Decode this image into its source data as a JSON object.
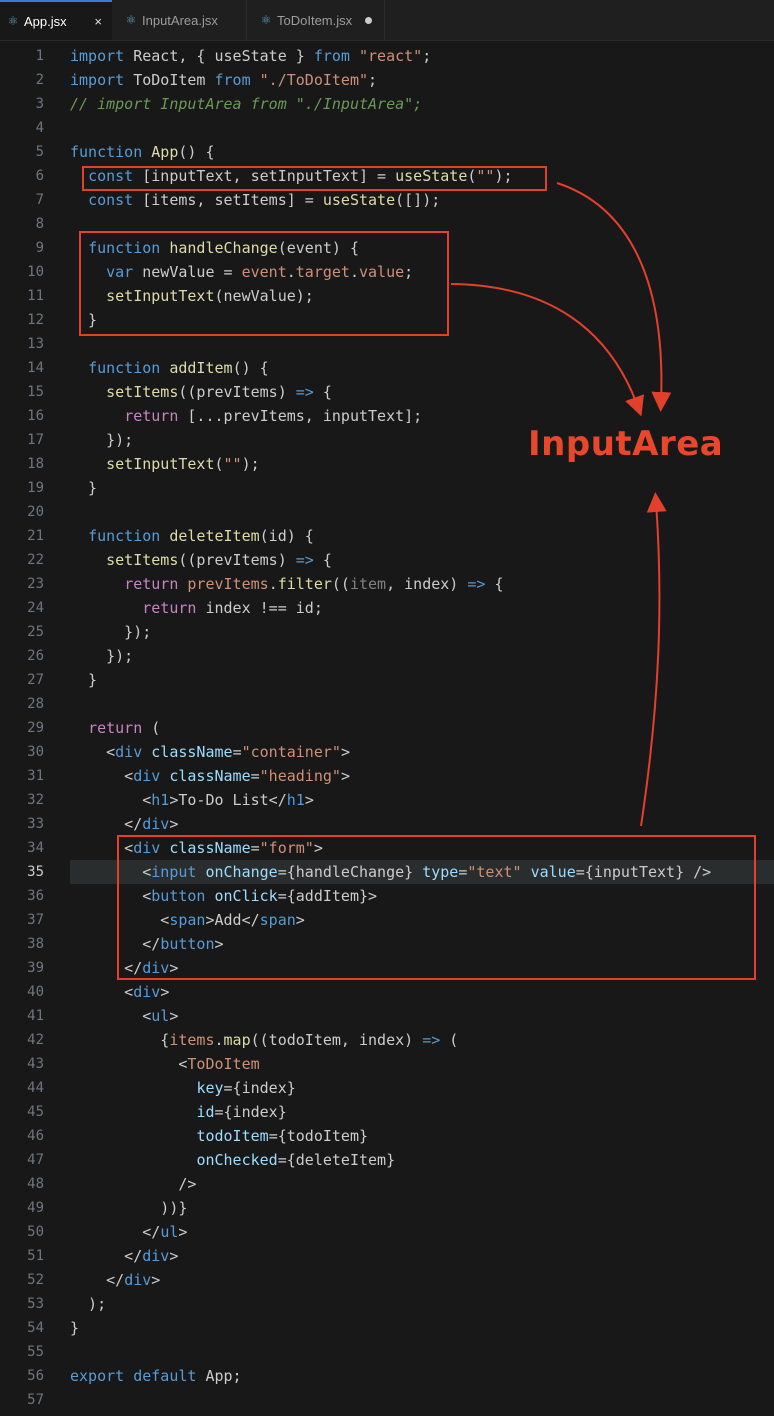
{
  "tabs": [
    {
      "label": "App.jsx",
      "icon": "react-icon",
      "active": true,
      "close": "×"
    },
    {
      "label": "InputArea.jsx",
      "icon": "react-icon",
      "active": false
    },
    {
      "label": "ToDoItem.jsx",
      "icon": "react-icon",
      "active": false,
      "modified": true
    }
  ],
  "annotation": {
    "label": "InputArea",
    "color": "#e2402a"
  },
  "colors": {
    "keyword": "#569cd6",
    "control": "#c586c0",
    "function": "#dcdcaa",
    "string": "#ce9178",
    "variable": "#9cdcfe",
    "comment": "#6a9955"
  },
  "editor": {
    "current_line": 35,
    "lines": [
      {
        "n": "1",
        "tokens": [
          [
            "kw",
            "import"
          ],
          [
            "txt",
            " React, { useState } "
          ],
          [
            "kw",
            "from"
          ],
          [
            "str",
            " \"react\""
          ],
          [
            "txt",
            ";"
          ]
        ]
      },
      {
        "n": "2",
        "tokens": [
          [
            "kw",
            "import"
          ],
          [
            "txt",
            " ToDoItem "
          ],
          [
            "kw",
            "from"
          ],
          [
            "str",
            " \"./ToDoItem\""
          ],
          [
            "txt",
            ";"
          ]
        ]
      },
      {
        "n": "3",
        "tokens": [
          [
            "cm",
            "// import InputArea from \"./InputArea\";"
          ]
        ]
      },
      {
        "n": "4",
        "tokens": []
      },
      {
        "n": "5",
        "tokens": [
          [
            "kw",
            "function"
          ],
          [
            "txt",
            " "
          ],
          [
            "fn",
            "App"
          ],
          [
            "txt",
            "() {"
          ]
        ]
      },
      {
        "n": "6",
        "tokens": [
          [
            "txt",
            "  "
          ],
          [
            "kw",
            "const"
          ],
          [
            "txt",
            " [inputText, setInputText] = "
          ],
          [
            "fn",
            "useState"
          ],
          [
            "txt",
            "("
          ],
          [
            "str",
            "\"\""
          ],
          [
            "txt",
            ");"
          ]
        ]
      },
      {
        "n": "7",
        "tokens": [
          [
            "txt",
            "  "
          ],
          [
            "kw",
            "const"
          ],
          [
            "txt",
            " [items, setItems] = "
          ],
          [
            "fn",
            "useState"
          ],
          [
            "txt",
            "([]);"
          ]
        ]
      },
      {
        "n": "8",
        "tokens": []
      },
      {
        "n": "9",
        "tokens": [
          [
            "txt",
            "  "
          ],
          [
            "kw",
            "function"
          ],
          [
            "txt",
            " "
          ],
          [
            "fn",
            "handleChange"
          ],
          [
            "txt",
            "(event) {"
          ]
        ]
      },
      {
        "n": "10",
        "tokens": [
          [
            "txt",
            "    "
          ],
          [
            "kw",
            "var"
          ],
          [
            "txt",
            " newValue = "
          ],
          [
            "str",
            "event"
          ],
          [
            "txt",
            "."
          ],
          [
            "str",
            "target"
          ],
          [
            "txt",
            "."
          ],
          [
            "str",
            "value"
          ],
          [
            "txt",
            ";"
          ]
        ]
      },
      {
        "n": "11",
        "tokens": [
          [
            "txt",
            "    "
          ],
          [
            "fn",
            "setInputText"
          ],
          [
            "txt",
            "(newValue);"
          ]
        ]
      },
      {
        "n": "12",
        "tokens": [
          [
            "txt",
            "  }"
          ]
        ]
      },
      {
        "n": "13",
        "tokens": []
      },
      {
        "n": "14",
        "tokens": [
          [
            "txt",
            "  "
          ],
          [
            "kw",
            "function"
          ],
          [
            "txt",
            " "
          ],
          [
            "fn",
            "addItem"
          ],
          [
            "txt",
            "() {"
          ]
        ]
      },
      {
        "n": "15",
        "tokens": [
          [
            "txt",
            "    "
          ],
          [
            "fn",
            "setItems"
          ],
          [
            "txt",
            "((prevItems) "
          ],
          [
            "kw",
            "=>"
          ],
          [
            "txt",
            " {"
          ]
        ]
      },
      {
        "n": "16",
        "tokens": [
          [
            "txt",
            "      "
          ],
          [
            "ctl",
            "return"
          ],
          [
            "txt",
            " [...prevItems, inputText];"
          ]
        ]
      },
      {
        "n": "17",
        "tokens": [
          [
            "txt",
            "    });"
          ]
        ]
      },
      {
        "n": "18",
        "tokens": [
          [
            "txt",
            "    "
          ],
          [
            "fn",
            "setInputText"
          ],
          [
            "txt",
            "("
          ],
          [
            "str",
            "\"\""
          ],
          [
            "txt",
            ");"
          ]
        ]
      },
      {
        "n": "19",
        "tokens": [
          [
            "txt",
            "  }"
          ]
        ]
      },
      {
        "n": "20",
        "tokens": []
      },
      {
        "n": "21",
        "tokens": [
          [
            "txt",
            "  "
          ],
          [
            "kw",
            "function"
          ],
          [
            "txt",
            " "
          ],
          [
            "fn",
            "deleteItem"
          ],
          [
            "txt",
            "(id) {"
          ]
        ]
      },
      {
        "n": "22",
        "tokens": [
          [
            "txt",
            "    "
          ],
          [
            "fn",
            "setItems"
          ],
          [
            "txt",
            "((prevItems) "
          ],
          [
            "kw",
            "=>"
          ],
          [
            "txt",
            " {"
          ]
        ]
      },
      {
        "n": "23",
        "tokens": [
          [
            "txt",
            "      "
          ],
          [
            "ctl",
            "return"
          ],
          [
            "txt",
            " "
          ],
          [
            "str",
            "prevItems"
          ],
          [
            "txt",
            "."
          ],
          [
            "fn",
            "filter"
          ],
          [
            "txt",
            "(("
          ],
          [
            "pun",
            "item"
          ],
          [
            "txt",
            ", index) "
          ],
          [
            "kw",
            "=>"
          ],
          [
            "txt",
            " {"
          ]
        ]
      },
      {
        "n": "24",
        "tokens": [
          [
            "txt",
            "        "
          ],
          [
            "ctl",
            "return"
          ],
          [
            "txt",
            " index !== id;"
          ]
        ]
      },
      {
        "n": "25",
        "tokens": [
          [
            "txt",
            "      });"
          ]
        ]
      },
      {
        "n": "26",
        "tokens": [
          [
            "txt",
            "    });"
          ]
        ]
      },
      {
        "n": "27",
        "tokens": [
          [
            "txt",
            "  }"
          ]
        ]
      },
      {
        "n": "28",
        "tokens": []
      },
      {
        "n": "29",
        "tokens": [
          [
            "txt",
            "  "
          ],
          [
            "ctl",
            "return"
          ],
          [
            "txt",
            " ("
          ]
        ]
      },
      {
        "n": "30",
        "tokens": [
          [
            "txt",
            "    <"
          ],
          [
            "tag",
            "div"
          ],
          [
            "txt",
            " "
          ],
          [
            "attr",
            "className"
          ],
          [
            "txt",
            "="
          ],
          [
            "str",
            "\"container\""
          ],
          [
            "txt",
            ">"
          ]
        ]
      },
      {
        "n": "31",
        "tokens": [
          [
            "txt",
            "      <"
          ],
          [
            "tag",
            "div"
          ],
          [
            "txt",
            " "
          ],
          [
            "attr",
            "className"
          ],
          [
            "txt",
            "="
          ],
          [
            "str",
            "\"heading\""
          ],
          [
            "txt",
            ">"
          ]
        ]
      },
      {
        "n": "32",
        "tokens": [
          [
            "txt",
            "        <"
          ],
          [
            "tag",
            "h1"
          ],
          [
            "txt",
            ">To-Do List</"
          ],
          [
            "tag",
            "h1"
          ],
          [
            "txt",
            ">"
          ]
        ]
      },
      {
        "n": "33",
        "tokens": [
          [
            "txt",
            "      </"
          ],
          [
            "tag",
            "div"
          ],
          [
            "txt",
            ">"
          ]
        ]
      },
      {
        "n": "34",
        "tokens": [
          [
            "txt",
            "      <"
          ],
          [
            "tag",
            "div"
          ],
          [
            "txt",
            " "
          ],
          [
            "attr",
            "className"
          ],
          [
            "txt",
            "="
          ],
          [
            "str",
            "\"form\""
          ],
          [
            "txt",
            ">"
          ]
        ]
      },
      {
        "n": "35",
        "tokens": [
          [
            "txt",
            "        <"
          ],
          [
            "tag",
            "input"
          ],
          [
            "txt",
            " "
          ],
          [
            "attr",
            "onChange"
          ],
          [
            "txt",
            "={handleChange} "
          ],
          [
            "attr",
            "type"
          ],
          [
            "txt",
            "="
          ],
          [
            "str",
            "\"text\""
          ],
          [
            "txt",
            " "
          ],
          [
            "attr",
            "value"
          ],
          [
            "txt",
            "={inputText} />"
          ]
        ]
      },
      {
        "n": "36",
        "tokens": [
          [
            "txt",
            "        <"
          ],
          [
            "tag",
            "button"
          ],
          [
            "txt",
            " "
          ],
          [
            "attr",
            "onClick"
          ],
          [
            "txt",
            "={addItem}>"
          ]
        ]
      },
      {
        "n": "37",
        "tokens": [
          [
            "txt",
            "          <"
          ],
          [
            "tag",
            "span"
          ],
          [
            "txt",
            ">Add</"
          ],
          [
            "tag",
            "span"
          ],
          [
            "txt",
            ">"
          ]
        ]
      },
      {
        "n": "38",
        "tokens": [
          [
            "txt",
            "        </"
          ],
          [
            "tag",
            "button"
          ],
          [
            "txt",
            ">"
          ]
        ]
      },
      {
        "n": "39",
        "tokens": [
          [
            "txt",
            "      </"
          ],
          [
            "tag",
            "div"
          ],
          [
            "txt",
            ">"
          ]
        ]
      },
      {
        "n": "40",
        "tokens": [
          [
            "txt",
            "      <"
          ],
          [
            "tag",
            "div"
          ],
          [
            "txt",
            ">"
          ]
        ]
      },
      {
        "n": "41",
        "tokens": [
          [
            "txt",
            "        <"
          ],
          [
            "tag",
            "ul"
          ],
          [
            "txt",
            ">"
          ]
        ]
      },
      {
        "n": "42",
        "tokens": [
          [
            "txt",
            "          {"
          ],
          [
            "str",
            "items"
          ],
          [
            "txt",
            "."
          ],
          [
            "fn",
            "map"
          ],
          [
            "txt",
            "((todoItem, index) "
          ],
          [
            "kw",
            "=>"
          ],
          [
            "txt",
            " ("
          ]
        ]
      },
      {
        "n": "43",
        "tokens": [
          [
            "txt",
            "            <"
          ],
          [
            "str",
            "ToDoItem"
          ]
        ]
      },
      {
        "n": "44",
        "tokens": [
          [
            "txt",
            "              "
          ],
          [
            "attr",
            "key"
          ],
          [
            "txt",
            "={index}"
          ]
        ]
      },
      {
        "n": "45",
        "tokens": [
          [
            "txt",
            "              "
          ],
          [
            "attr",
            "id"
          ],
          [
            "txt",
            "={index}"
          ]
        ]
      },
      {
        "n": "46",
        "tokens": [
          [
            "txt",
            "              "
          ],
          [
            "attr",
            "todoItem"
          ],
          [
            "txt",
            "={todoItem}"
          ]
        ]
      },
      {
        "n": "47",
        "tokens": [
          [
            "txt",
            "              "
          ],
          [
            "attr",
            "onChecked"
          ],
          [
            "txt",
            "={deleteItem}"
          ]
        ]
      },
      {
        "n": "48",
        "tokens": [
          [
            "txt",
            "            />"
          ]
        ]
      },
      {
        "n": "49",
        "tokens": [
          [
            "txt",
            "          ))}"
          ]
        ]
      },
      {
        "n": "50",
        "tokens": [
          [
            "txt",
            "        </"
          ],
          [
            "tag",
            "ul"
          ],
          [
            "txt",
            ">"
          ]
        ]
      },
      {
        "n": "51",
        "tokens": [
          [
            "txt",
            "      </"
          ],
          [
            "tag",
            "div"
          ],
          [
            "txt",
            ">"
          ]
        ]
      },
      {
        "n": "52",
        "tokens": [
          [
            "txt",
            "    </"
          ],
          [
            "tag",
            "div"
          ],
          [
            "txt",
            ">"
          ]
        ]
      },
      {
        "n": "53",
        "tokens": [
          [
            "txt",
            "  );"
          ]
        ]
      },
      {
        "n": "54",
        "tokens": [
          [
            "txt",
            "}"
          ]
        ]
      },
      {
        "n": "55",
        "tokens": []
      },
      {
        "n": "56",
        "tokens": [
          [
            "kw",
            "export"
          ],
          [
            "txt",
            " "
          ],
          [
            "kw",
            "default"
          ],
          [
            "txt",
            " App;"
          ]
        ]
      },
      {
        "n": "57",
        "tokens": []
      }
    ]
  }
}
